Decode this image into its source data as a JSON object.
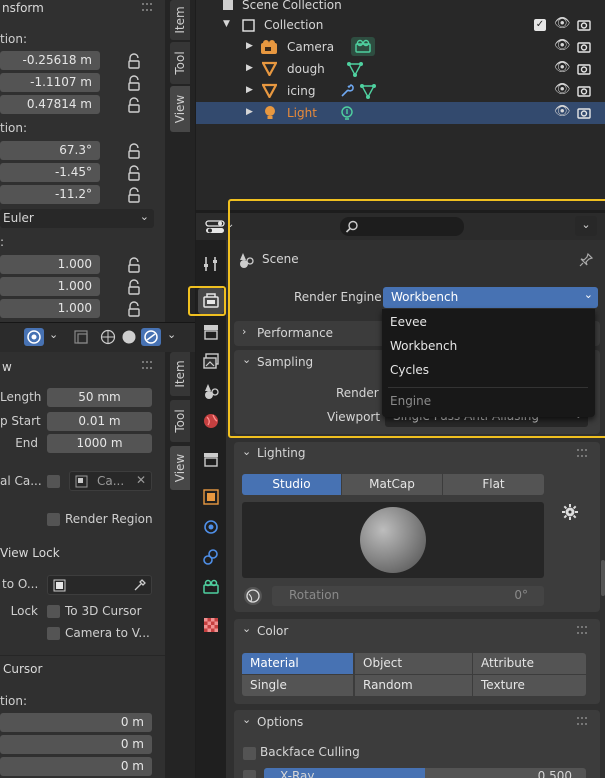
{
  "left_top": {
    "section_title": "nsform",
    "location_label": "tion:",
    "location": [
      "-0.25618 m",
      "-1.1107 m",
      "0.47814 m"
    ],
    "rotation_label": "tion:",
    "rotation": [
      "67.3°",
      "-1.45°",
      "-11.2°"
    ],
    "rotation_mode": "Euler",
    "scale_label": ":",
    "scale": [
      "1.000",
      "1.000",
      "1.000"
    ],
    "tabs": [
      "Item",
      "Tool",
      "View"
    ]
  },
  "left_bottom": {
    "view_title": "w",
    "focal_length_label": "Length",
    "focal_length": "50 mm",
    "clip_start_label": "p Start",
    "clip_start": "0.01 m",
    "clip_end_label": "End",
    "clip_end": "1000 m",
    "local_camera_label": "al Ca...",
    "local_camera_value": "Ca...",
    "render_region": "Render Region",
    "view_lock_title": "View Lock",
    "lock_to_object_label": "to O...",
    "lock_label": "Lock",
    "to_3d_cursor": "To 3D Cursor",
    "camera_to_view": "Camera to V...",
    "cursor_title": "Cursor",
    "cursor_location_label": "tion:",
    "cursor_location": [
      "0 m",
      "0 m",
      "0 m"
    ],
    "tabs": [
      "Item",
      "Tool",
      "View"
    ]
  },
  "outliner": {
    "scene_collection": "Scene Collection",
    "collection": "Collection",
    "items": [
      {
        "name": "Camera",
        "icon": "camera-object-icon",
        "data_icon": "camera-data-icon",
        "color": "#d6d6d6"
      },
      {
        "name": "dough",
        "icon": "mesh-object-icon",
        "data_icon": "mesh-data-icon",
        "color": "#d6d6d6"
      },
      {
        "name": "icing",
        "icon": "mesh-object-icon",
        "data_icon": "modifier-wrench-icon",
        "color": "#d6d6d6"
      },
      {
        "name": "Light",
        "icon": "light-object-icon",
        "data_icon": "light-data-icon",
        "color": "#e88a3a"
      }
    ]
  },
  "properties": {
    "search_placeholder": "",
    "context_title": "Scene",
    "render_engine_label": "Render Engine",
    "render_engine_value": "Workbench",
    "engine_options": [
      "Eevee",
      "Workbench",
      "Cycles"
    ],
    "engine_footer": "Engine",
    "performance": "Performance",
    "sampling": "Sampling",
    "render_label": "Render",
    "viewport_label": "Viewport",
    "viewport_value": "Single Pass Anti-Aliasing",
    "lighting": "Lighting",
    "lighting_options": [
      "Studio",
      "MatCap",
      "Flat"
    ],
    "rotation_label": "Rotation",
    "rotation_value": "0°",
    "color": "Color",
    "color_options": [
      "Material",
      "Object",
      "Attribute",
      "Single",
      "Random",
      "Texture"
    ],
    "options": "Options",
    "backface_culling": "Backface Culling",
    "xray_label": "X-Ray",
    "xray_value": "0.500"
  },
  "colors": {
    "highlight": "#f0c020",
    "accent": "#4772b3",
    "light_orange": "#e88a3a"
  }
}
